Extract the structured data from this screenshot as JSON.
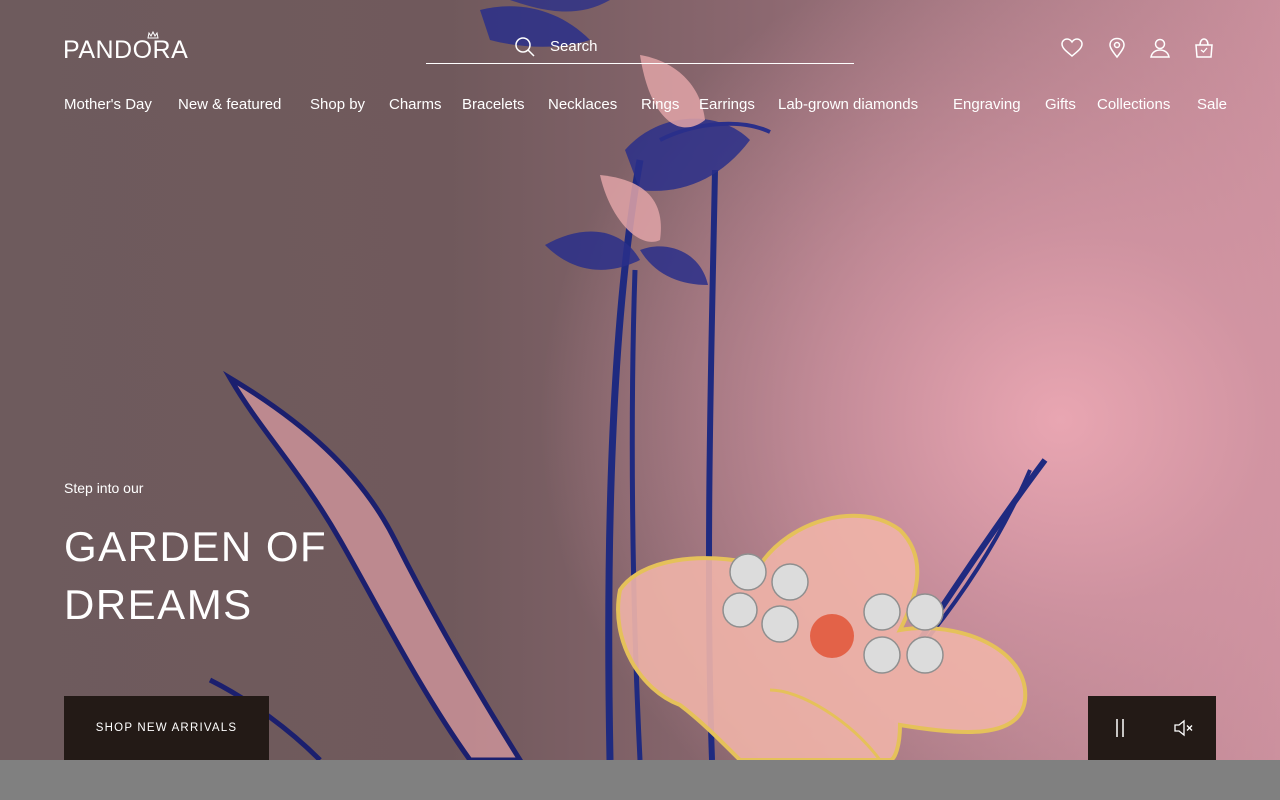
{
  "brand": {
    "name": "PANDORA"
  },
  "search": {
    "placeholder": "Search"
  },
  "header_icons": [
    {
      "name": "heart-icon",
      "label": "Wishlist"
    },
    {
      "name": "location-pin-icon",
      "label": "Store locator"
    },
    {
      "name": "user-icon",
      "label": "Account"
    },
    {
      "name": "shopping-bag-icon",
      "label": "Bag"
    }
  ],
  "nav": {
    "items": [
      {
        "label": "Mother's Day"
      },
      {
        "label": "New & featured"
      },
      {
        "label": "Shop by"
      },
      {
        "label": "Charms"
      },
      {
        "label": "Bracelets"
      },
      {
        "label": "Necklaces"
      },
      {
        "label": "Rings"
      },
      {
        "label": "Earrings"
      },
      {
        "label": "Lab-grown diamonds"
      },
      {
        "label": "Engraving"
      },
      {
        "label": "Gifts"
      },
      {
        "label": "Collections"
      },
      {
        "label": "Sale"
      }
    ]
  },
  "hero": {
    "kicker": "Step into our",
    "title": "GARDEN OF DREAMS",
    "cta": "SHOP NEW ARRIVALS",
    "controls": {
      "pause_icon": "pause-icon",
      "mute_icon": "muted-speaker-icon"
    }
  },
  "colors": {
    "cta_bg": "#231a16",
    "hero_pink": "#e8a8b4",
    "ink_blue": "#1f2a80"
  }
}
